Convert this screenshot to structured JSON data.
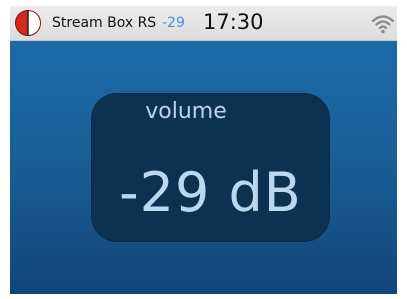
{
  "statusbar": {
    "device_name": "Stream Box RS",
    "volume_short": "-29",
    "clock": "17:30",
    "logo_icon": "brand-logo-icon",
    "wifi_icon": "wifi-icon"
  },
  "volume_panel": {
    "label": "volume",
    "value": "-29 dB"
  },
  "colors": {
    "accent": "#4a8fd6",
    "screen_top": "#1d6aa8",
    "screen_bottom": "#12457a",
    "panel": "#0c3252",
    "logo_red": "#d42a1e"
  }
}
